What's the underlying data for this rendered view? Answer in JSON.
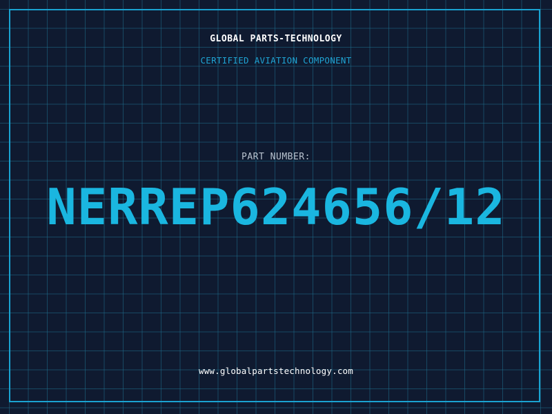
{
  "header": {
    "brand": "GLOBAL PARTS-TECHNOLOGY",
    "tagline": "CERTIFIED AVIATION COMPONENT"
  },
  "part": {
    "label": "PART NUMBER:",
    "number": "NERREP624656/12"
  },
  "footer": {
    "url": "www.globalpartstechnology.com"
  },
  "colors": {
    "background": "#0f1a30",
    "grid": "#1e6e8c",
    "accent": "#1ab6e0",
    "text": "#ffffff",
    "muted": "#b9c3cf"
  }
}
